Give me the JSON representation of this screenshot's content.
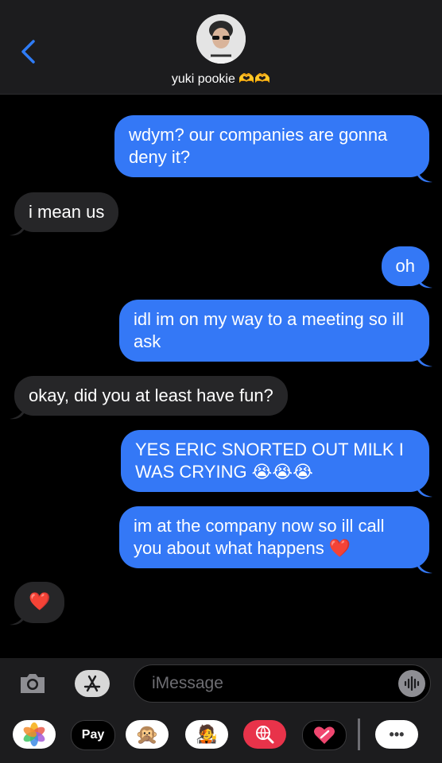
{
  "header": {
    "contact_name": "yuki pookie 🫶🫶"
  },
  "messages": [
    {
      "from": "me",
      "text": "wdym? our companies are gonna deny it?"
    },
    {
      "from": "them",
      "text": "i mean us"
    },
    {
      "from": "me",
      "text": "oh"
    },
    {
      "from": "me",
      "text": "idl im on my way to a meeting so ill ask"
    },
    {
      "from": "them",
      "text": "okay, did you at least have fun?"
    },
    {
      "from": "me",
      "text": "YES ERIC SNORTED OUT MILK I WAS CRYING 😭😭😭"
    },
    {
      "from": "me",
      "text": "im at the company now so ill call you about what happens ❤️"
    },
    {
      "from": "them",
      "text": "❤️"
    }
  ],
  "input": {
    "placeholder": "iMessage"
  },
  "apps": {
    "applepay_label": "Pay",
    "apple_glyph": "",
    "memoji": "🙊",
    "avatars": "🧑‍🎤",
    "more": "•••"
  },
  "colors": {
    "outgoing": "#3478f6",
    "incoming": "#262628",
    "accent": "#2f7cf6"
  }
}
